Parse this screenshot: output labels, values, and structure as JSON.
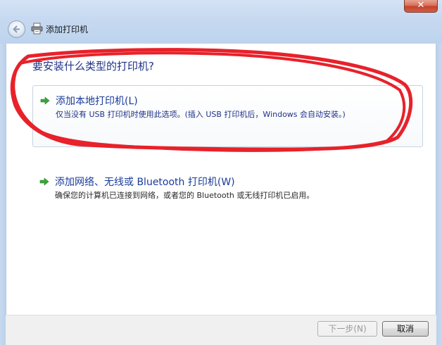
{
  "window": {
    "title": "添加打印机",
    "close_label": "✕"
  },
  "question": "要安装什么类型的打印机?",
  "options": [
    {
      "title": "添加本地打印机(L)",
      "description": "仅当没有 USB 打印机时使用此选项。(插入 USB 打印机后，Windows 会自动安装。)"
    },
    {
      "title": "添加网络、无线或 Bluetooth 打印机(W)",
      "description": "确保您的计算机已连接到网络，或者您的 Bluetooth 或无线打印机已启用。"
    }
  ],
  "footer": {
    "next_label": "下一步(N)",
    "cancel_label": "取消"
  },
  "icons": {
    "back": "back-arrow-icon",
    "printer": "printer-icon",
    "option_arrow": "green-arrow-icon"
  },
  "colors": {
    "link_blue": "#1a3b9a",
    "annotation_red": "#e8212a",
    "arrow_green": "#3aa63a"
  }
}
